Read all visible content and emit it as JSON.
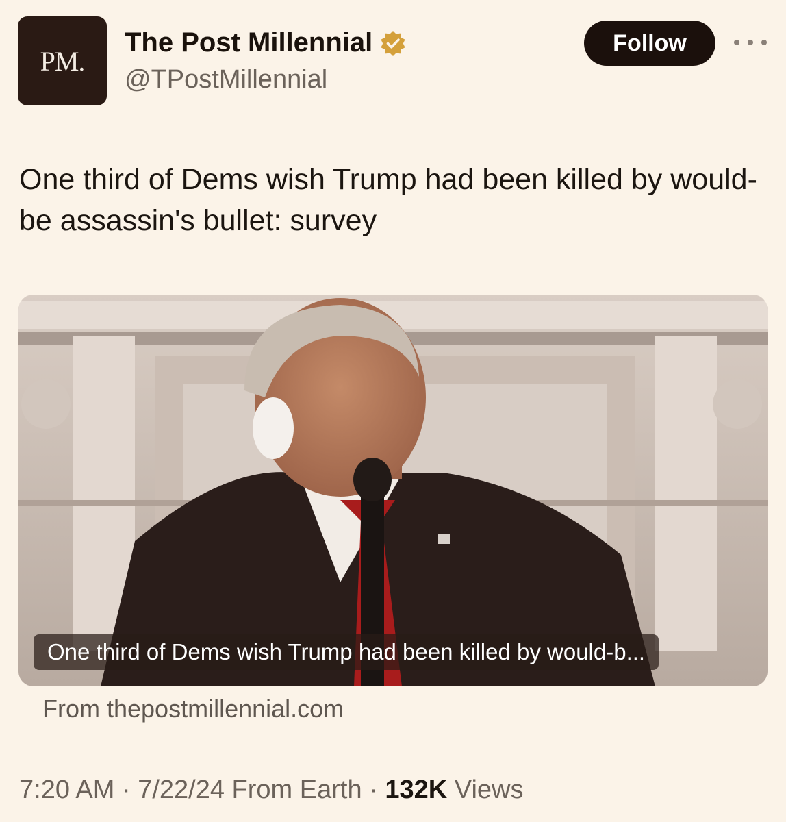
{
  "author": {
    "avatar_text": "PM.",
    "display_name": "The Post Millennial",
    "handle": "@TPostMillennial",
    "verified_badge": "gold-verified-icon"
  },
  "header": {
    "follow_label": "Follow",
    "more_icon": "ellipsis-icon"
  },
  "tweet": {
    "text": "One third of Dems wish Trump had been killed by would-be assassin's bullet: survey"
  },
  "card": {
    "caption": "One third of Dems wish Trump had been killed by would-b...",
    "source": "From thepostmillennial.com"
  },
  "meta": {
    "time": "7:20 AM",
    "sep1": " · ",
    "date": "7/22/24",
    "location": " From Earth",
    "sep2": " · ",
    "views_count": "132K",
    "views_label": " Views"
  },
  "colors": {
    "background": "#fbf3e8",
    "follow_button": "#1b100c",
    "verified_gold": "#d4a03b"
  }
}
